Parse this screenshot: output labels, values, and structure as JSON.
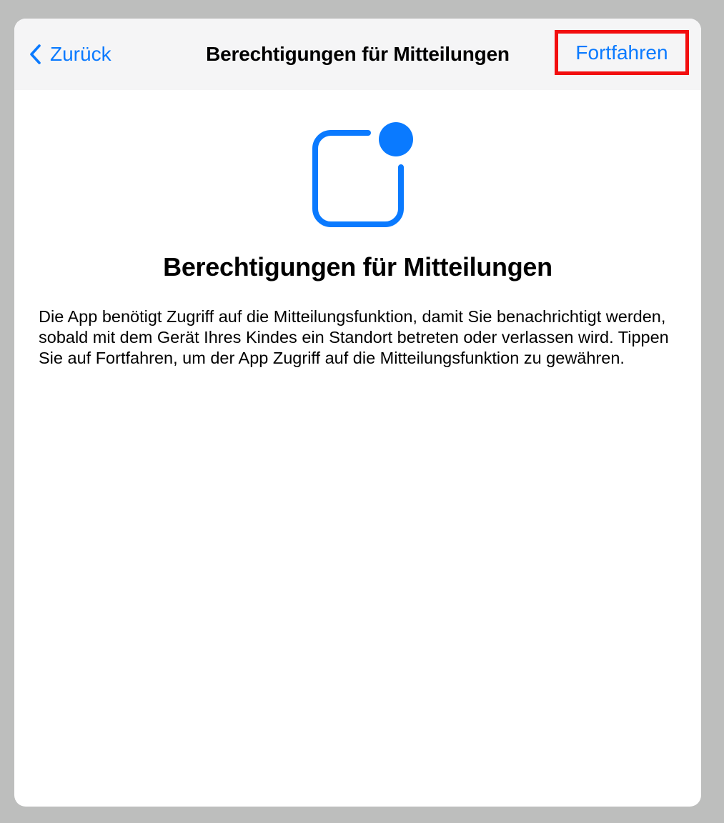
{
  "nav": {
    "back_label": "Zurück",
    "title": "Berechtigungen für Mitteilungen",
    "continue_label": "Fortfahren"
  },
  "content": {
    "icon": "notification-badge-icon",
    "title": "Berechtigungen für Mitteilungen",
    "body": "Die App benötigt Zugriff auf die Mitteilungsfunktion, damit Sie benachrichtigt werden, sobald mit dem Gerät Ihres Kindes ein Standort betreten oder verlassen wird. Tippen Sie auf Fortfahren, um der App Zugriff auf die Mitteilungsfunktion zu gewähren."
  },
  "colors": {
    "accent": "#0a7aff",
    "highlight": "#f20e0f",
    "backdrop": "#bdbebd",
    "navbar": "#f5f5f6"
  }
}
